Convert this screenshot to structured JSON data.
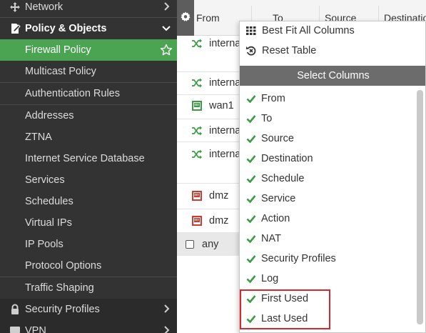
{
  "sidebar": {
    "network": {
      "label": "Network",
      "icon": "move-arrows-icon"
    },
    "policy_objects": {
      "label": "Policy & Objects",
      "icon": "policy-document-icon"
    },
    "items": [
      {
        "label": "Firewall Policy",
        "active": true
      },
      {
        "label": "Multicast Policy"
      },
      {
        "label": "Authentication Rules"
      },
      {
        "label": "Addresses"
      },
      {
        "label": "ZTNA"
      },
      {
        "label": "Internet Service Database"
      },
      {
        "label": "Services"
      },
      {
        "label": "Schedules"
      },
      {
        "label": "Virtual IPs"
      },
      {
        "label": "IP Pools"
      },
      {
        "label": "Protocol Options"
      },
      {
        "label": "Traffic Shaping"
      }
    ],
    "security_profiles": {
      "label": "Security Profiles",
      "icon": "lock-icon"
    },
    "vpn": {
      "label": "VPN",
      "icon": "vpn-monitor-icon"
    }
  },
  "table": {
    "columns": [
      "From",
      "To",
      "Source",
      "Destination"
    ],
    "rows": [
      {
        "from": "interna",
        "icon": "shuffle-icon"
      },
      {
        "from": "interna",
        "icon": "shuffle-icon"
      },
      {
        "from": "wan1",
        "icon": "wan-port-icon"
      },
      {
        "from": "interna",
        "icon": "shuffle-icon"
      },
      {
        "from": "interna",
        "icon": "shuffle-icon"
      },
      {
        "from": "dmz",
        "icon": "dmz-port-icon"
      },
      {
        "from": "dmz",
        "icon": "dmz-port-icon"
      },
      {
        "from": "any",
        "icon": "checkbox"
      }
    ]
  },
  "menu": {
    "best_fit": "Best Fit All Columns",
    "reset": "Reset Table",
    "select_columns": "Select Columns",
    "columns": [
      "From",
      "To",
      "Source",
      "Destination",
      "Schedule",
      "Service",
      "Action",
      "NAT",
      "Security Profiles",
      "Log",
      "First Used",
      "Last Used"
    ],
    "highlighted": [
      "First Used",
      "Last Used"
    ]
  },
  "colors": {
    "sidebar_bg": "#333333",
    "active_green": "#4aa451",
    "check_green": "#3a9b46",
    "highlight_red": "#d9262c"
  }
}
